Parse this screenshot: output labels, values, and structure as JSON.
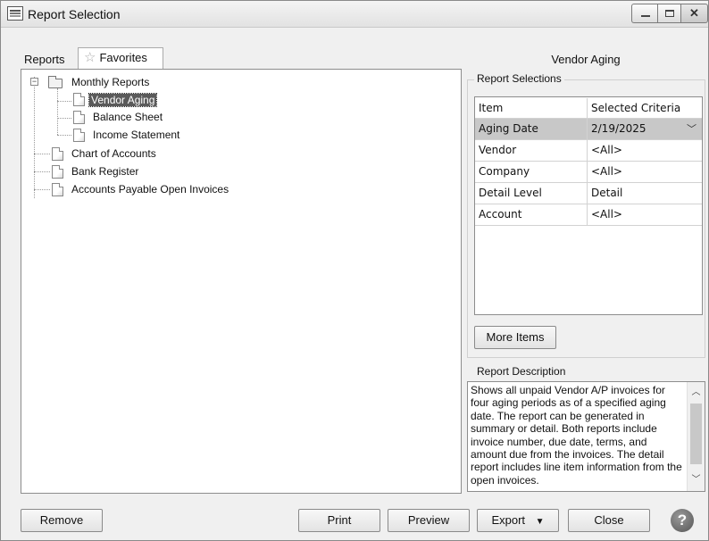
{
  "window": {
    "title": "Report Selection"
  },
  "tabs": [
    {
      "label": "Reports"
    },
    {
      "label": "Favorites"
    }
  ],
  "tree": {
    "items": [
      {
        "label": "Monthly Reports",
        "type": "folder",
        "expanded": true
      },
      {
        "label": "Vendor Aging",
        "type": "report",
        "selected": true
      },
      {
        "label": "Balance Sheet",
        "type": "report"
      },
      {
        "label": "Income Statement",
        "type": "report"
      },
      {
        "label": "Chart of Accounts",
        "type": "report"
      },
      {
        "label": "Bank Register",
        "type": "report"
      },
      {
        "label": "Accounts Payable Open Invoices",
        "type": "report"
      }
    ],
    "expander_glyph": "−"
  },
  "report": {
    "title": "Vendor Aging",
    "selections_caption": "Report Selections",
    "grid": {
      "headers": [
        "Item",
        "Selected Criteria"
      ],
      "rows": [
        [
          "Aging Date",
          "2/19/2025"
        ],
        [
          "Vendor",
          "<All>"
        ],
        [
          "Company",
          "<All>"
        ],
        [
          "Detail Level",
          "Detail"
        ],
        [
          "Account",
          "<All>"
        ]
      ],
      "selected_row": 0
    },
    "more_items_label": "More Items",
    "description_caption": "Report Description",
    "description": "Shows all unpaid Vendor A/P invoices for four aging periods as of a specified aging date. The report can be generated in summary or detail.  Both reports include invoice number, due date, terms, and amount due from the invoices. The detail report includes line item information from the open invoices."
  },
  "buttons": {
    "remove": "Remove",
    "print": "Print",
    "preview": "Preview",
    "export": "Export",
    "close": "Close",
    "help": "?"
  },
  "icons": {
    "minimize": "minimize-icon",
    "maximize": "maximize-icon",
    "close": "close-icon",
    "favorites": "star-icon",
    "dropdown": "chevron-down-icon",
    "scroll_up": "scroll-up-icon",
    "scroll_down": "scroll-down-icon",
    "help": "help-icon"
  },
  "colors": {
    "selection": "#5a5a5a",
    "selected_row": "#c8c8c8",
    "window_bg": "#f0f0f0"
  }
}
